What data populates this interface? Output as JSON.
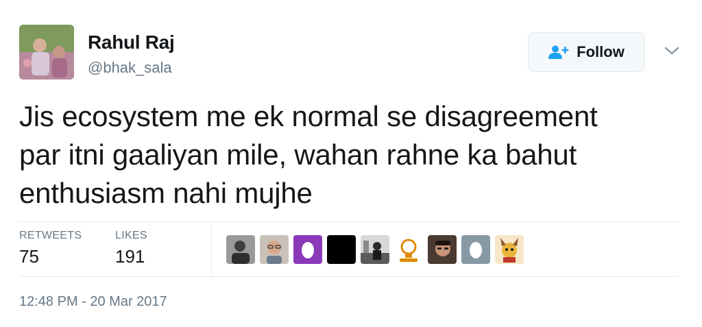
{
  "author": {
    "name": "Rahul Raj",
    "handle": "@bhak_sala",
    "avatar_icon": "profile-photo"
  },
  "follow_button": {
    "label": "Follow",
    "icon": "add-user-icon",
    "icon_color": "#1da1f2"
  },
  "menu_caret_icon": "chevron-down-icon",
  "tweet": {
    "text_lines": [
      "Jis ecosystem me ek normal se disagreement",
      "par itni gaaliyan mile, wahan rahne ka bahut",
      "enthusiasm nahi mujhe"
    ]
  },
  "stats": {
    "retweets_label": "RETWEETS",
    "retweets_value": "75",
    "likes_label": "LIKES",
    "likes_value": "191"
  },
  "likers": [
    {
      "icon": "user-avatar-bw-photo",
      "color": "#5a5a5a"
    },
    {
      "icon": "user-avatar-glasses-photo",
      "color": "#a89a8a"
    },
    {
      "icon": "default-egg-avatar-purple",
      "color": "#8a3ab9"
    },
    {
      "icon": "user-avatar-black",
      "color": "#000000"
    },
    {
      "icon": "user-avatar-bw-scene",
      "color": "#6e6e6e"
    },
    {
      "icon": "user-avatar-bulb-logo",
      "color": "#e08a00"
    },
    {
      "icon": "user-avatar-man-photo",
      "color": "#3a2a22"
    },
    {
      "icon": "default-egg-avatar-gray",
      "color": "#8899a6"
    },
    {
      "icon": "user-avatar-cartoon",
      "color": "#e8b43c"
    }
  ],
  "timestamp": "12:48 PM - 20 Mar 2017",
  "colors": {
    "text_primary": "#14171a",
    "text_secondary": "#657786",
    "border": "#e6ecf0",
    "accent": "#1da1f2"
  }
}
